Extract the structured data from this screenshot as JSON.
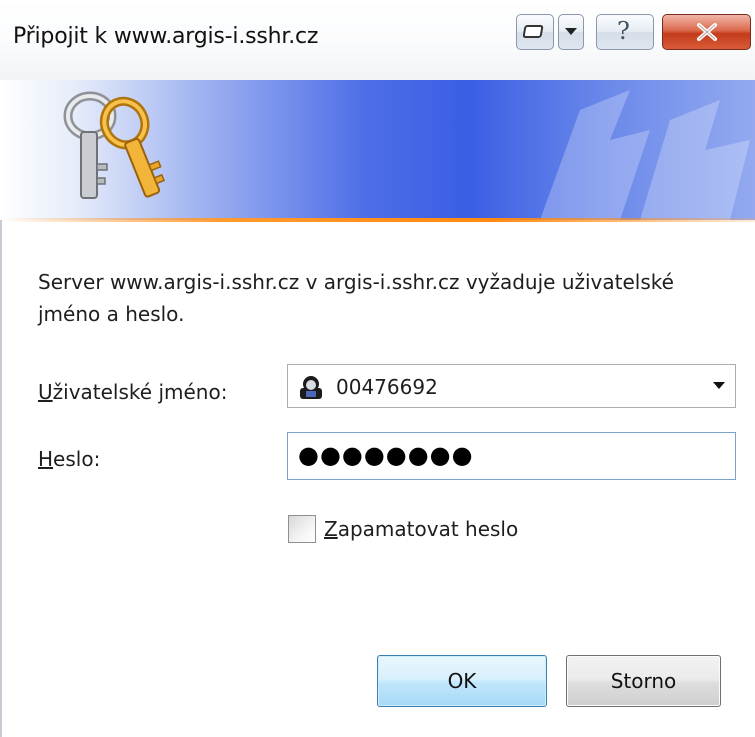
{
  "window": {
    "title": "Připojit k www.argis-i.sshr.cz",
    "help_glyph": "?"
  },
  "dialog": {
    "message": "Server www.argis-i.sshr.cz v argis-i.sshr.cz vyžaduje uživatelské jméno a heslo.",
    "username": {
      "label_accel": "U",
      "label_rest": "živatelské jméno:",
      "value": "00476692"
    },
    "password": {
      "label_accel": "H",
      "label_rest": "eslo:",
      "masked_value": "●●●●●●●●"
    },
    "remember": {
      "label_accel": "Z",
      "label_rest": "apamatovat heslo",
      "checked": false
    },
    "buttons": {
      "ok": "OK",
      "cancel": "Storno"
    }
  },
  "icons": {
    "banner": "keys-icon",
    "user": "user-account-icon",
    "close": "close-icon",
    "help": "help-icon",
    "system_menu": "window-menu-icon",
    "combo": "chevron-down-icon"
  },
  "colors": {
    "banner_blue": "#3a5ee4",
    "accent_orange": "#ff8a10",
    "close_red": "#c33c1c",
    "ok_button_blue": "#bee6fd"
  }
}
